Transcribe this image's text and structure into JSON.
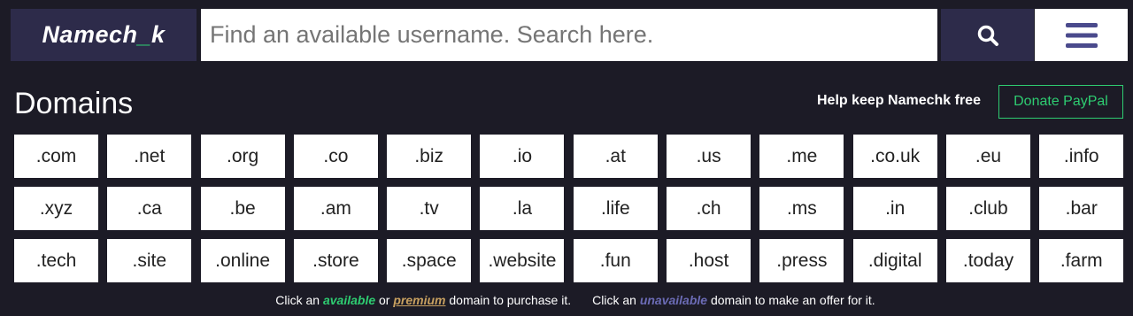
{
  "logo": {
    "text_before": "Namech",
    "underscore": "_",
    "text_after": "k"
  },
  "search": {
    "placeholder": "Find an available username. Search here.",
    "value": ""
  },
  "icons": {
    "search_button": "search-icon",
    "menu_button": "hamburger-menu-icon"
  },
  "section": {
    "title": "Domains"
  },
  "support": {
    "help_text": "Help keep Namechk free",
    "donate_label": "Donate PayPal"
  },
  "domains": [
    ".com",
    ".net",
    ".org",
    ".co",
    ".biz",
    ".io",
    ".at",
    ".us",
    ".me",
    ".co.uk",
    ".eu",
    ".info",
    ".xyz",
    ".ca",
    ".be",
    ".am",
    ".tv",
    ".la",
    ".life",
    ".ch",
    ".ms",
    ".in",
    ".club",
    ".bar",
    ".tech",
    ".site",
    ".online",
    ".store",
    ".space",
    ".website",
    ".fun",
    ".host",
    ".press",
    ".digital",
    ".today",
    ".farm"
  ],
  "footer": {
    "part1": "Click an",
    "available": "available",
    "or": "or",
    "premium": "premium",
    "part2": "domain to purchase it.",
    "part3": "Click an",
    "unavailable": "unavailable",
    "part4": "domain to make an offer for it."
  },
  "colors": {
    "background": "#1c1b26",
    "brand_dark": "#2d2b4a",
    "accent_green": "#2ecc71",
    "premium_gold": "#c8a060",
    "unavailable_purple": "#6b6bb5"
  }
}
